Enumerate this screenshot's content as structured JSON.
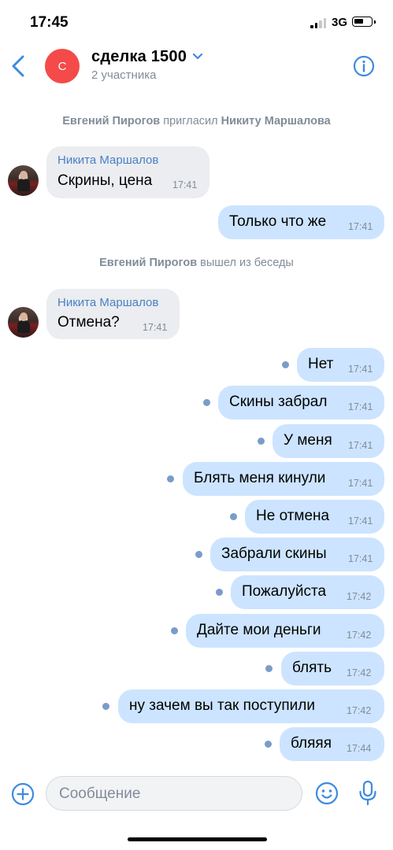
{
  "status_bar": {
    "time": "17:45",
    "network": "3G"
  },
  "header": {
    "avatar_letter": "С",
    "title": "сделка 1500",
    "subtitle": "2 участника",
    "icons": {
      "back": "chevron-left-icon",
      "expand": "chevron-down-icon",
      "info": "info-icon"
    }
  },
  "events": [
    {
      "actor": "Евгений Пирогов",
      "text": "пригласил",
      "target": "Никиту Маршалова"
    },
    {
      "actor": "Евгений Пирогов",
      "text": "вышел из беседы",
      "target": ""
    }
  ],
  "messages": [
    {
      "dir": "in",
      "sender": "Никита Маршалов",
      "text": "Скрины, цена",
      "time": "17:41"
    },
    {
      "dir": "out",
      "text": "Только что же",
      "time": "17:41",
      "unread": false
    },
    {
      "dir": "in",
      "sender": "Никита Маршалов",
      "text": "Отмена?",
      "time": "17:41"
    },
    {
      "dir": "out",
      "text": "Нет",
      "time": "17:41",
      "unread": true
    },
    {
      "dir": "out",
      "text": "Скины забрал",
      "time": "17:41",
      "unread": true
    },
    {
      "dir": "out",
      "text": "У меня",
      "time": "17:41",
      "unread": true
    },
    {
      "dir": "out",
      "text": "Блять меня кинули",
      "time": "17:41",
      "unread": true
    },
    {
      "dir": "out",
      "text": "Не отмена",
      "time": "17:41",
      "unread": true
    },
    {
      "dir": "out",
      "text": "Забрали скины",
      "time": "17:41",
      "unread": true
    },
    {
      "dir": "out",
      "text": "Пожалуйста",
      "time": "17:42",
      "unread": true
    },
    {
      "dir": "out",
      "text": "Дайте мои деньги",
      "time": "17:42",
      "unread": true
    },
    {
      "dir": "out",
      "text": "блять",
      "time": "17:42",
      "unread": true
    },
    {
      "dir": "out",
      "text": "ну зачем вы так поступили",
      "time": "17:42",
      "unread": true
    },
    {
      "dir": "out",
      "text": "бляяя",
      "time": "17:44",
      "unread": true
    }
  ],
  "composer": {
    "placeholder": "Сообщение",
    "icons": {
      "attach": "plus-circle-icon",
      "emoji": "smile-icon",
      "voice": "microphone-icon"
    }
  },
  "colors": {
    "accent": "#4a80c4",
    "avatar": "#f44a4a",
    "incoming": "#ebedf0",
    "outgoing": "#cce4ff",
    "muted": "#818c99"
  }
}
